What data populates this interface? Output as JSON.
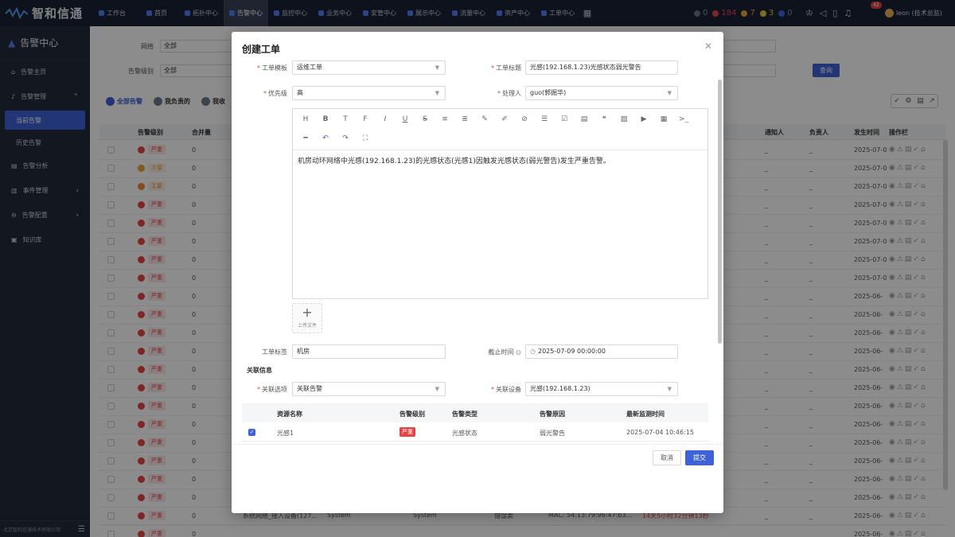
{
  "app": {
    "logo_text": "智和信通"
  },
  "topnav": {
    "items": [
      {
        "label": "工作台"
      },
      {
        "label": "首页"
      },
      {
        "label": "拓扑中心"
      },
      {
        "label": "告警中心",
        "active": true
      },
      {
        "label": "监控中心"
      },
      {
        "label": "业务中心"
      },
      {
        "label": "安管中心"
      },
      {
        "label": "展示中心"
      },
      {
        "label": "流量中心"
      },
      {
        "label": "资产中心"
      },
      {
        "label": "工单中心"
      }
    ],
    "alarm_counts": [
      {
        "value": "0",
        "color": "#6b7385"
      },
      {
        "value": "184",
        "color": "#e54545"
      },
      {
        "value": "7",
        "color": "#e8a33a"
      },
      {
        "value": "3",
        "color": "#e8c33a"
      },
      {
        "value": "0",
        "color": "#3e63d9"
      }
    ],
    "notification_badge": "42",
    "user": "leon (技术总监)"
  },
  "sidebar": {
    "header": "告警中心",
    "items": [
      {
        "label": "告警主页"
      },
      {
        "label": "告警管理",
        "expanded": true
      },
      {
        "label": "当前告警",
        "active": true
      },
      {
        "label": "历史告警"
      },
      {
        "label": "告警分析"
      },
      {
        "label": "事件管理"
      },
      {
        "label": "告警配置"
      },
      {
        "label": "知识库"
      }
    ],
    "footer": "北京智和信通技术有限公司"
  },
  "background": {
    "filters": {
      "network_label": "网络",
      "network_value": "全部",
      "level_label": "告警级别",
      "level_value": "全部",
      "query_button": "查询"
    },
    "tabs": [
      "全部告警",
      "我负责的",
      "我收"
    ],
    "table_headers": {
      "level": "告警级别",
      "merge": "合并量",
      "notify": "通知人",
      "owner": "负责人",
      "time": "发生时间",
      "ops": "操作栏"
    },
    "rows": [
      {
        "level": "严重",
        "count": "0",
        "notify": "_",
        "owner": "_",
        "time": "2025-07-0",
        "color": "#e54545"
      },
      {
        "level": "次要",
        "count": "0",
        "notify": "_",
        "owner": "_",
        "time": "2025-07-0",
        "color": "#e8a33a"
      },
      {
        "level": "主要",
        "count": "0",
        "notify": "_",
        "owner": "_",
        "time": "2025-07-0",
        "color": "#f08a3a"
      },
      {
        "level": "严重",
        "count": "0",
        "notify": "_",
        "owner": "_",
        "time": "2025-07-0",
        "color": "#e54545"
      },
      {
        "level": "严重",
        "count": "0",
        "notify": "_",
        "owner": "_",
        "time": "2025-07-0",
        "color": "#e54545"
      },
      {
        "level": "严重",
        "count": "0",
        "notify": "_",
        "owner": "_",
        "time": "2025-07-0",
        "color": "#e54545"
      },
      {
        "level": "严重",
        "count": "0",
        "notify": "_",
        "owner": "_",
        "time": "2025-07-0",
        "color": "#e54545"
      },
      {
        "level": "严重",
        "count": "0",
        "notify": "_",
        "owner": "_",
        "time": "2025-07-0",
        "color": "#e54545"
      },
      {
        "level": "严重",
        "count": "0",
        "notify": "_",
        "owner": "_",
        "time": "2025-06-",
        "color": "#e54545"
      },
      {
        "level": "严重",
        "count": "0",
        "notify": "_",
        "owner": "_",
        "time": "2025-06-",
        "color": "#e54545"
      },
      {
        "level": "严重",
        "count": "0",
        "notify": "_",
        "owner": "_",
        "time": "2025-06-",
        "color": "#e54545"
      },
      {
        "level": "严重",
        "count": "0",
        "notify": "_",
        "owner": "_",
        "time": "2025-06-",
        "color": "#e54545"
      },
      {
        "level": "严重",
        "count": "0",
        "notify": "_",
        "owner": "_",
        "time": "2025-06-",
        "color": "#e54545"
      },
      {
        "level": "严重",
        "count": "0",
        "notify": "_",
        "owner": "_",
        "time": "2025-06-",
        "color": "#e54545"
      },
      {
        "level": "严重",
        "count": "0",
        "notify": "_",
        "owner": "_",
        "time": "2025-06-",
        "color": "#e54545"
      },
      {
        "level": "严重",
        "count": "0",
        "notify": "_",
        "owner": "_",
        "time": "2025-06-",
        "color": "#e54545"
      },
      {
        "level": "严重",
        "count": "0",
        "notify": "_",
        "owner": "_",
        "time": "2025-06-",
        "color": "#e54545"
      },
      {
        "level": "严重",
        "count": "0",
        "notify": "_",
        "owner": "_",
        "time": "2025-06-",
        "color": "#e54545"
      },
      {
        "level": "严重",
        "count": "0",
        "notify": "_",
        "owner": "_",
        "time": "2025-06-",
        "color": "#e54545"
      },
      {
        "level": "严重",
        "count": "0",
        "notify": "_",
        "owner": "_",
        "time": "2025-06-",
        "color": "#e54545"
      },
      {
        "level": "严重",
        "count": "0",
        "notify": "_",
        "owner": "_",
        "time": "2025-06-",
        "color": "#e54545"
      },
      {
        "level": "严重",
        "count": "0",
        "notify": "_",
        "owner": "_",
        "time": "2025-06-",
        "color": "#e54545"
      }
    ],
    "last_row": {
      "resource": "系统网络_接入设备(127...",
      "type1": "System",
      "type2": "System",
      "cause": "错误类",
      "mac": "MAC: 54:13:79:96:47:b3...",
      "duration": "14天5小时32分钟13秒"
    }
  },
  "modal": {
    "title": "创建工单",
    "fields": {
      "template_label": "工单模板",
      "template_value": "运维工单",
      "title_label": "工单标题",
      "title_value": "光感(192.168.1.23)光感状态弱光警告",
      "priority_label": "优先级",
      "priority_value": "高",
      "handler_label": "处理人",
      "handler_value": "guo(郭掘华)",
      "content": "机房动环网络中光感(192.168.1.23)的光感状态(光感1)因触发光感状态(弱光警告)发生严重告警。",
      "upload_label": "上传文件",
      "tag_label": "工单标签",
      "tag_value": "机房",
      "deadline_label": "截止时间",
      "deadline_value": "2025-07-09 00:00:00",
      "relation_section": "关联信息",
      "relation_option_label": "关联选项",
      "relation_option_value": "关联告警",
      "relation_device_label": "关联设备",
      "relation_device_value": "光感(192.168.1.23)"
    },
    "toolbar_icons": [
      "heading-icon",
      "bold-icon",
      "font-size-icon",
      "font-family-icon",
      "italic-icon",
      "underline-icon",
      "strikethrough-icon",
      "indent-icon",
      "list-add-icon",
      "pen-icon",
      "brush-icon",
      "link-icon",
      "bullet-list-icon",
      "checkbox-icon",
      "align-icon",
      "quote-icon",
      "image-icon",
      "video-icon",
      "table-icon",
      "code-icon",
      "divider-icon",
      "undo-icon",
      "redo-icon",
      "fullscreen-icon"
    ],
    "related_table": {
      "headers": {
        "name": "资源名称",
        "level": "告警级别",
        "type": "告警类型",
        "cause": "告警原因",
        "time": "最新监测时间"
      },
      "rows": [
        {
          "name": "光感1",
          "level": "严重",
          "type": "光感状态",
          "cause": "弱光警告",
          "time": "2025-07-04 10:46:15"
        }
      ]
    },
    "buttons": {
      "cancel": "取消",
      "submit": "提交"
    }
  }
}
